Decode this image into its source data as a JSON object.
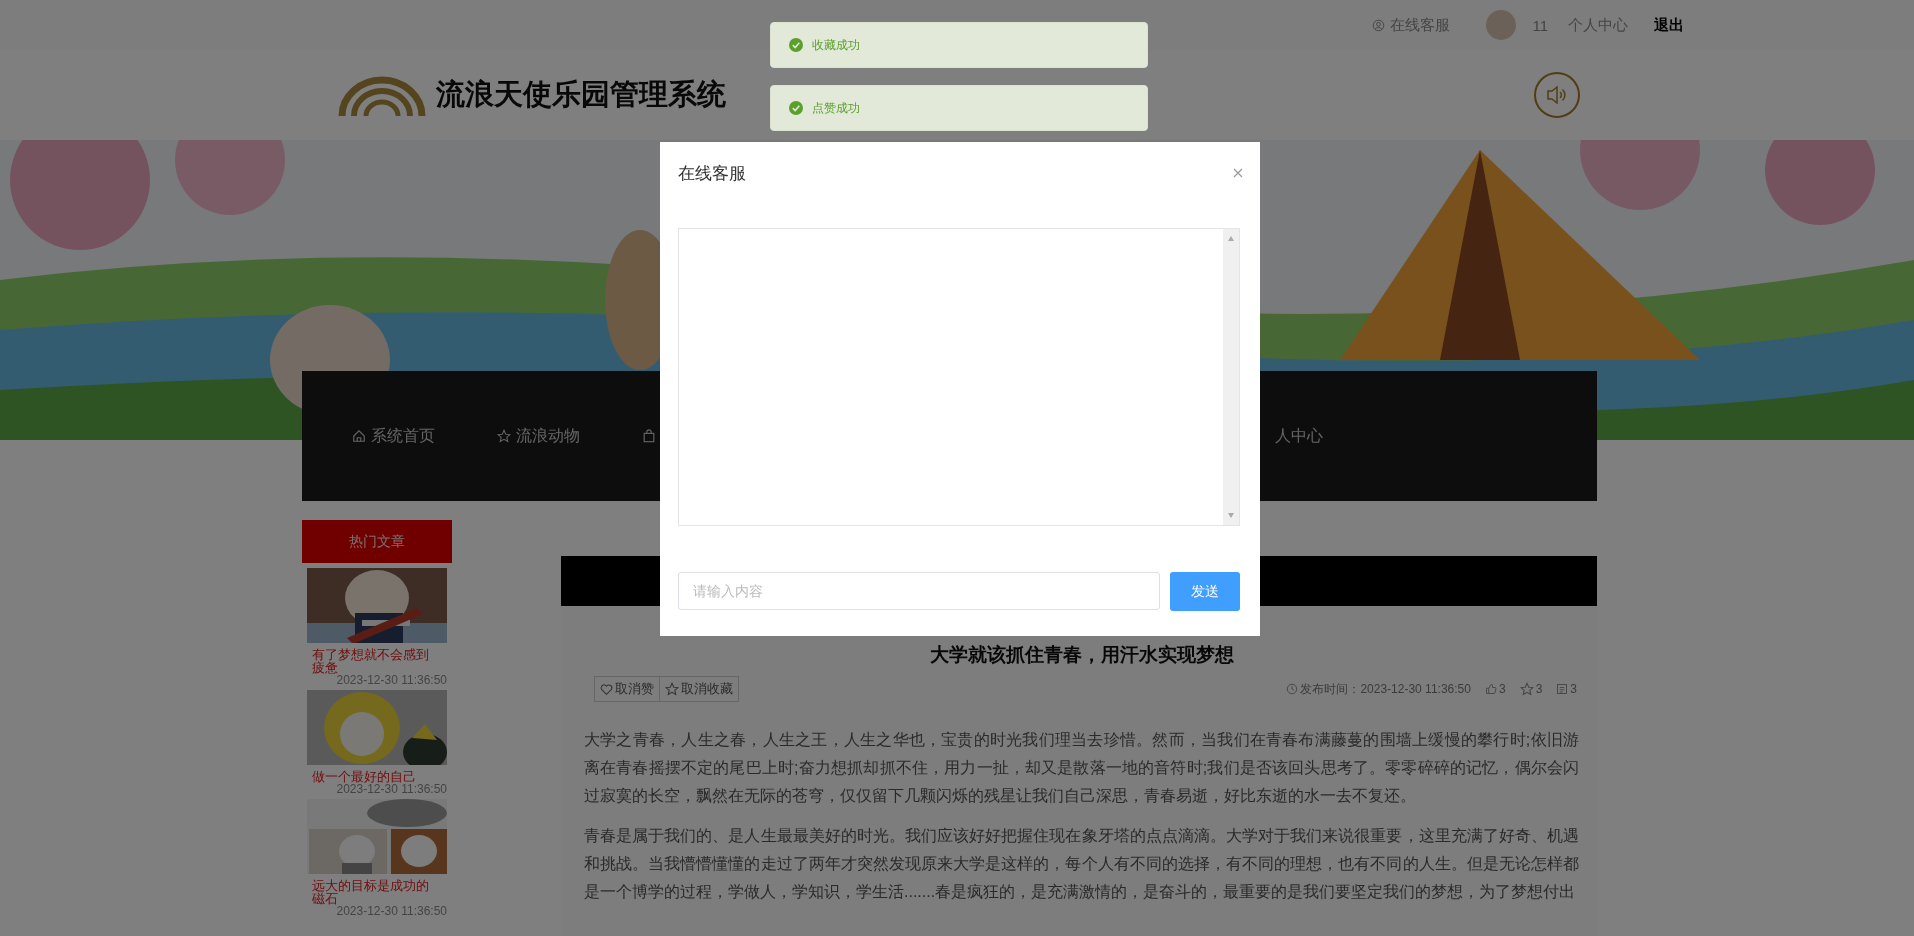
{
  "top_bar": {
    "service": "在线客服",
    "user_id": "11",
    "profile": "个人中心",
    "logout": "退出"
  },
  "toasts": [
    {
      "kind": "success",
      "text": "收藏成功"
    },
    {
      "kind": "success",
      "text": "点赞成功"
    }
  ],
  "header": {
    "title": "流浪天使乐园管理系统"
  },
  "nav": [
    {
      "kind": "home",
      "label": "系统首页"
    },
    {
      "kind": "star",
      "label": "流浪动物"
    },
    {
      "kind": "bag"
    },
    {
      "label": "人中心"
    }
  ],
  "sidebar": {
    "title": "热门文章",
    "articles": [
      {
        "title": "有了梦想就不会感到疲惫",
        "date": "2023-12-30 11:36:50"
      },
      {
        "title": "做一个最好的自己",
        "date": "2023-12-30 11:36:50"
      },
      {
        "title": "远大的目标是成功的磁石",
        "date": "2023-12-30 11:36:50"
      }
    ]
  },
  "article": {
    "title": "大学就该抓住青春，用汗水实现梦想",
    "actions": [
      {
        "kind": "heart",
        "label": "取消赞"
      },
      {
        "kind": "star",
        "label": "取消收藏"
      }
    ],
    "published": "发布时间：2023-12-30 11:36:50",
    "likes": "3",
    "favorites": "3",
    "comments": "3",
    "paragraphs": [
      "大学之青春，人生之春，人生之王，人生之华也，宝贵的时光我们理当去珍惜。然而，当我们在青春布满藤蔓的围墙上缓慢的攀行时;依旧游离在青春摇摆不定的尾巴上时;奋力想抓却抓不住，用力一扯，却又是散落一地的音符时;我们是否该回头思考了。零零碎碎的记忆，偶尔会闪过寂寞的长空，飘然在无际的苍穹，仅仅留下几颗闪烁的残星让我们自己深思，青春易逝，好比东逝的水一去不复还。",
      "青春是属于我们的、是人生最最美好的时光。我们应该好好把握住现在象牙塔的点点滴滴。大学对于我们来说很重要，这里充满了好奇、机遇和挑战。当我懵懵懂懂的走过了两年才突然发现原来大学是这样的，每个人有不同的选择，有不同的理想，也有不同的人生。但是无论怎样都是一个博学的过程，学做人，学知识，学生活.......春是疯狂的，是充满激情的，是奋斗的，最重要的是我们要坚定我们的梦想，为了梦想付出"
    ]
  },
  "dialog": {
    "title": "在线客服",
    "placeholder": "请输入内容",
    "send": "发送"
  }
}
